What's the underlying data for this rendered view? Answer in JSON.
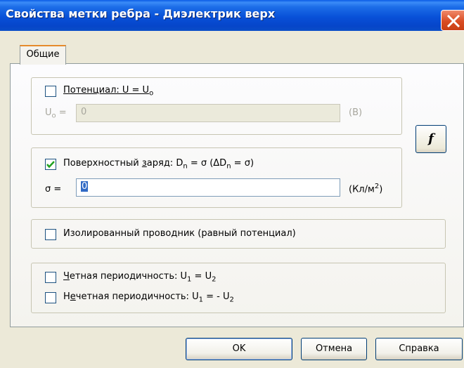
{
  "window": {
    "title": "Свойства метки ребра - Диэлектрик верх"
  },
  "tabs": [
    {
      "label": "Общие"
    }
  ],
  "potential": {
    "checkbox_label": "Потенциал: U = U",
    "checkbox_sub": "o",
    "checked": false,
    "field_label": "U",
    "field_label_sub": "o",
    "field_label_eq": " =",
    "value": "0",
    "unit": "(В)"
  },
  "function_button": {
    "label": "f"
  },
  "surface_charge": {
    "checkbox_label_pre": "Поверхностный ",
    "checkbox_label_u": "з",
    "checkbox_label_post": "аряд: D",
    "sub_n": "n",
    "formula": " = σ (ΔD",
    "sub_n2": "n",
    "formula_end": " = σ)",
    "checked": true,
    "field_label": "σ =",
    "value": "0",
    "unit": "(Кл/м",
    "unit_sup": "2",
    "unit_end": ")"
  },
  "isolated_conductor": {
    "label": "Изолированный проводник  (равный потенциал)",
    "checked": false
  },
  "periodicity": {
    "even_u": "Ч",
    "even_rest": "етная периодичность: U",
    "even_sub1": "1",
    "even_eq": " = U",
    "even_sub2": "2",
    "even_checked": false,
    "odd_pre": "Н",
    "odd_u": "е",
    "odd_rest": "четная периодичность: U",
    "odd_sub1": "1",
    "odd_eq": " = - U",
    "odd_sub2": "2",
    "odd_checked": false
  },
  "buttons": {
    "ok": "OK",
    "cancel": "Отмена",
    "help": "Справка"
  }
}
